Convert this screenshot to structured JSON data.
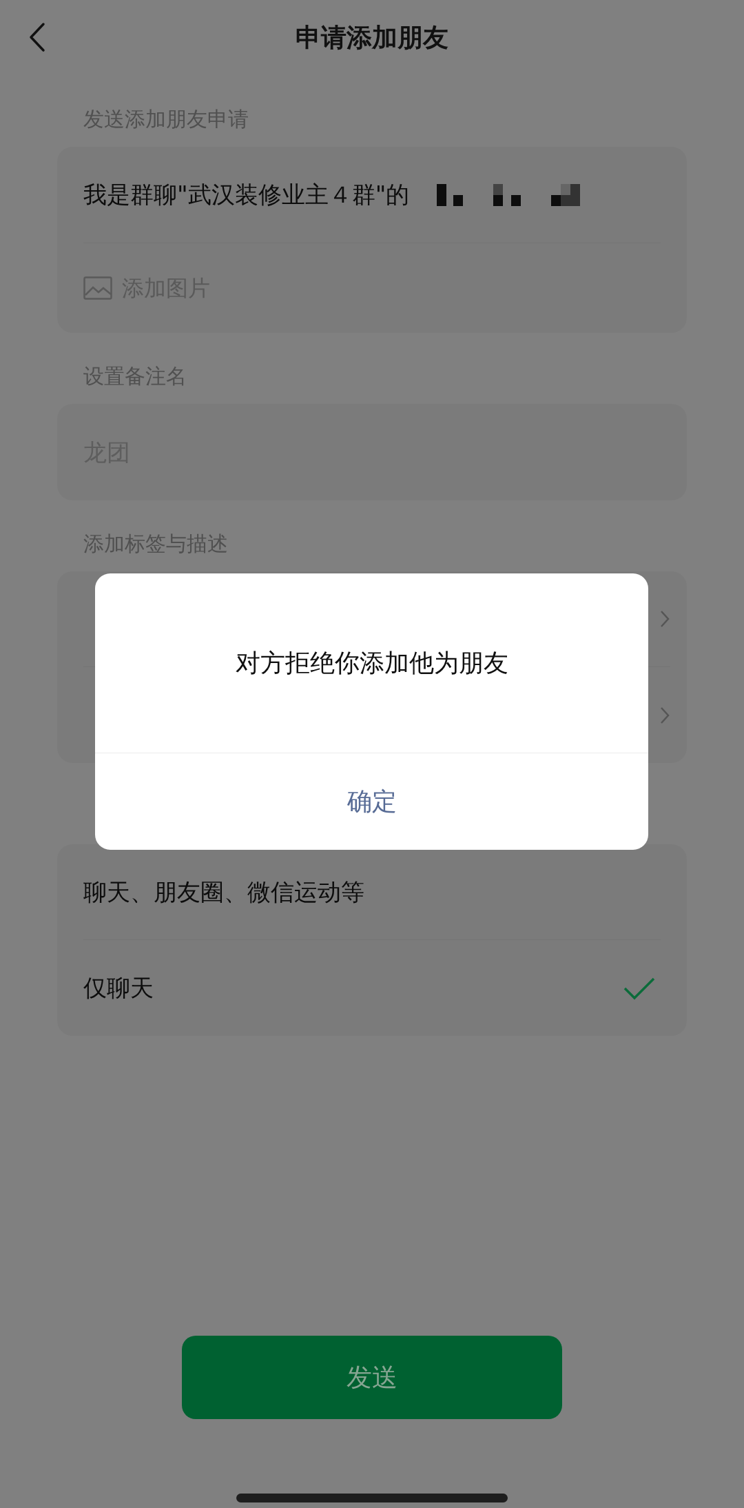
{
  "header": {
    "title": "申请添加朋友"
  },
  "request": {
    "label": "发送添加朋友申请",
    "message": "我是群聊\"武汉装修业主４群\"的",
    "add_image": "添加图片"
  },
  "remark": {
    "label": "设置备注名",
    "placeholder": "龙团"
  },
  "tags": {
    "label": "添加标签与描述",
    "rows": [
      {
        "kind": "link"
      },
      {
        "kind": "link"
      }
    ]
  },
  "permissions": {
    "options": [
      {
        "label": "聊天、朋友圈、微信运动等",
        "selected": false
      },
      {
        "label": "仅聊天",
        "selected": true
      }
    ]
  },
  "send_button": "发送",
  "dialog": {
    "message": "对方拒绝你添加他为朋友",
    "confirm": "确定"
  }
}
